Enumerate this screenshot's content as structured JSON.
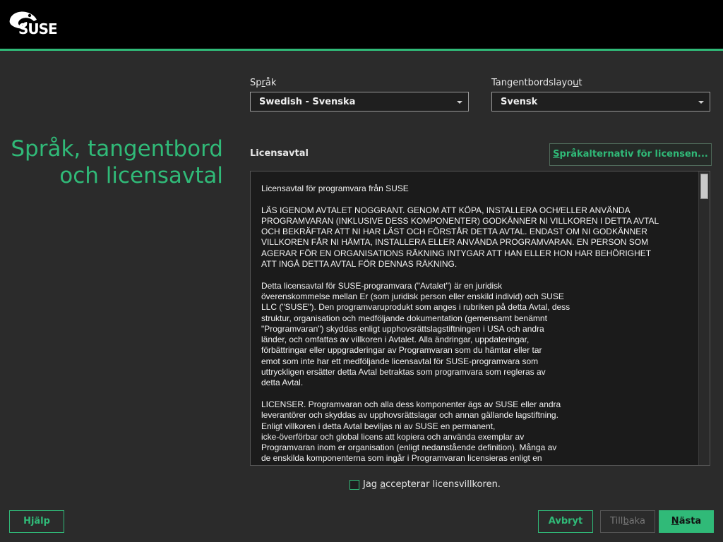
{
  "header": {
    "logo_text": "SUSE"
  },
  "page": {
    "title_line1": "Språk, tangentbord",
    "title_line2": "och licensavtal"
  },
  "language": {
    "label_pre": "Sp",
    "label_ul": "r",
    "label_post": "åk",
    "selected": "Swedish - Svenska"
  },
  "keyboard": {
    "label_pre": "Tangentbordslayo",
    "label_ul": "u",
    "label_post": "t",
    "selected": "Svensk"
  },
  "license": {
    "section_label": "Licensavtal",
    "options_button_ul": "S",
    "options_button_rest": "pråkalternativ för licensen...",
    "paragraphs": [
      "Licensavtal för programvara från SUSE",
      "LÄS IGENOM AVTALET NOGGRANT. GENOM ATT KÖPA, INSTALLERA OCH/ELLER ANVÄNDA\nPROGRAMVARAN (INKLUSIVE DESS KOMPONENTER) GODKÄNNER NI VILLKOREN I DETTA AVTAL\nOCH BEKRÄFTAR ATT NI HAR LÄST OCH FÖRSTÅR DETTA AVTAL. ENDAST OM NI GODKÄNNER\nVILLKOREN FÅR NI HÄMTA, INSTALLERA ELLER ANVÄNDA PROGRAMVARAN. EN PERSON SOM\nAGERAR FÖR EN ORGANISATIONS RÄKNING INTYGAR ATT HAN ELLER HON HAR BEHÖRIGHET\nATT INGÅ DETTA AVTAL FÖR DENNAS RÄKNING.",
      "Detta licensavtal för SUSE-programvara (\"Avtalet\") är en juridisk\növerenskommelse mellan Er (som juridisk person eller enskild individ) och SUSE\nLLC (\"SUSE\"). Den programvaruprodukt som anges i rubriken på detta Avtal, dess\nstruktur, organisation och medföljande dokumentation (gemensamt benämnt\n\"Programvaran\") skyddas enligt upphovsrättslagstiftningen i USA och andra\nländer, och omfattas av villkoren i Avtalet. Alla ändringar, uppdateringar,\nförbättringar eller uppgraderingar av Programvaran som du hämtar eller tar\nemot som inte har ett medföljande licensavtal för SUSE-programvara som\nuttryckligen ersätter detta Avtal betraktas som programvara som regleras av\ndetta Avtal.",
      "LICENSER. Programvaran och alla dess komponenter ägs av SUSE eller andra\nleverantörer och skyddas av upphovsrättslagar och annan gällande lagstiftning.\nEnligt villkoren i detta Avtal beviljas ni av SUSE en permanent,\nicke-överförbar och global licens att kopiera och använda exemplar av\nProgramvaran inom er organisation (enligt nedanstående definition). Många av\nde enskilda komponenterna som ingår i Programvaran licensieras enligt en"
    ]
  },
  "accept": {
    "label_pre": "Jag ",
    "label_ul": "a",
    "label_post": "ccepterar licensvillkoren.",
    "checked": false
  },
  "buttons": {
    "help": "Hjälp",
    "abort": "Avbryt",
    "back_pre": "Till",
    "back_ul": "b",
    "back_post": "aka",
    "next_ul": "N",
    "next_post": "ästa"
  },
  "colors": {
    "accent": "#30ba78",
    "background": "#2b2b2b",
    "topbar": "#000000"
  }
}
